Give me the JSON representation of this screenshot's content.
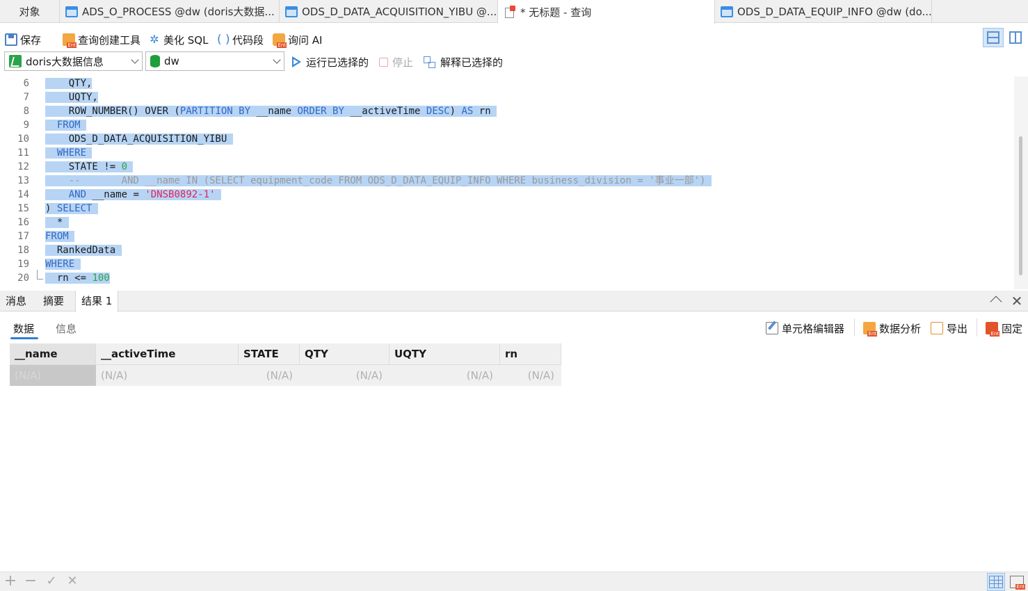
{
  "tabs": [
    {
      "label": "对象",
      "icon": "none"
    },
    {
      "label": "ADS_O_PROCESS @dw (doris大数据...",
      "icon": "table-icon"
    },
    {
      "label": "ODS_D_DATA_ACQUISITION_YIBU @...",
      "icon": "table-icon"
    },
    {
      "label": "* 无标题 - 查询",
      "icon": "query-icon",
      "active": true
    },
    {
      "label": "ODS_D_DATA_EQUIP_INFO @dw (do...",
      "icon": "table-icon"
    }
  ],
  "toolbar": {
    "save": "保存",
    "query_builder": "查询创建工具",
    "beautify": "美化 SQL",
    "snippet": "代码段",
    "ask_ai": "询问 AI"
  },
  "connection": {
    "name": "doris大数据信息",
    "database": "dw",
    "run_selected": "运行已选择的",
    "stop": "停止",
    "explain_selected": "解释已选择的"
  },
  "editor": {
    "line_numbers": [
      "6",
      "7",
      "8",
      "9",
      "10",
      "11",
      "12",
      "13",
      "14",
      "15",
      "16",
      "17",
      "18",
      "19",
      "20"
    ],
    "lines": [
      [
        {
          "t": "    QTY,",
          "c": ""
        }
      ],
      [
        {
          "t": "    UQTY,",
          "c": ""
        }
      ],
      [
        {
          "t": "    ROW_NUMBER() OVER (",
          "c": ""
        },
        {
          "t": "PARTITION BY",
          "c": "kw"
        },
        {
          "t": " __name ",
          "c": ""
        },
        {
          "t": "ORDER BY",
          "c": "kw"
        },
        {
          "t": " __activeTime ",
          "c": ""
        },
        {
          "t": "DESC",
          "c": "kw"
        },
        {
          "t": ") ",
          "c": ""
        },
        {
          "t": "AS",
          "c": "kw"
        },
        {
          "t": " rn ",
          "c": ""
        }
      ],
      [
        {
          "t": "  ",
          "c": ""
        },
        {
          "t": "FROM",
          "c": "kw"
        },
        {
          "t": " ",
          "c": ""
        }
      ],
      [
        {
          "t": "    ODS_D_DATA_ACQUISITION_YIBU ",
          "c": ""
        }
      ],
      [
        {
          "t": "  ",
          "c": ""
        },
        {
          "t": "WHERE",
          "c": "kw"
        },
        {
          "t": " ",
          "c": ""
        }
      ],
      [
        {
          "t": "    STATE != ",
          "c": ""
        },
        {
          "t": "0",
          "c": "num"
        },
        {
          "t": " ",
          "c": ""
        }
      ],
      [
        {
          "t": "    --       AND __name IN (SELECT equipment_code FROM ODS_D_DATA_EQUIP_INFO WHERE business_division = '事业一部') ",
          "c": "cmt"
        }
      ],
      [
        {
          "t": "    ",
          "c": ""
        },
        {
          "t": "AND",
          "c": "kw"
        },
        {
          "t": " __name = ",
          "c": ""
        },
        {
          "t": "'DNSB0892-1'",
          "c": "str"
        },
        {
          "t": " ",
          "c": ""
        }
      ],
      [
        {
          "t": ") ",
          "c": ""
        },
        {
          "t": "SELECT",
          "c": "kw"
        },
        {
          "t": " ",
          "c": ""
        }
      ],
      [
        {
          "t": "  * ",
          "c": ""
        }
      ],
      [
        {
          "t": "FROM",
          "c": "kw"
        },
        {
          "t": " ",
          "c": ""
        }
      ],
      [
        {
          "t": "  RankedData ",
          "c": ""
        }
      ],
      [
        {
          "t": "WHERE",
          "c": "kw"
        },
        {
          "t": " ",
          "c": ""
        }
      ],
      [
        {
          "t": "  rn <= ",
          "c": ""
        },
        {
          "t": "100",
          "c": "num"
        }
      ]
    ]
  },
  "result_tabs": [
    "消息",
    "摘要",
    "结果 1"
  ],
  "result_subtabs": {
    "data": "数据",
    "info": "信息"
  },
  "result_actions": {
    "cell_editor": "单元格编辑器",
    "data_analysis": "数据分析",
    "export": "导出",
    "pin": "固定"
  },
  "grid": {
    "columns": [
      "__name",
      "__activeTime",
      "STATE",
      "QTY",
      "UQTY",
      "rn"
    ],
    "row": [
      "(N/A)",
      "(N/A)",
      "(N/A)",
      "(N/A)",
      "(N/A)",
      "(N/A)"
    ]
  },
  "bottom_bar": {
    "add": "+",
    "remove": "−",
    "apply": "✓",
    "cancel": "✕"
  }
}
